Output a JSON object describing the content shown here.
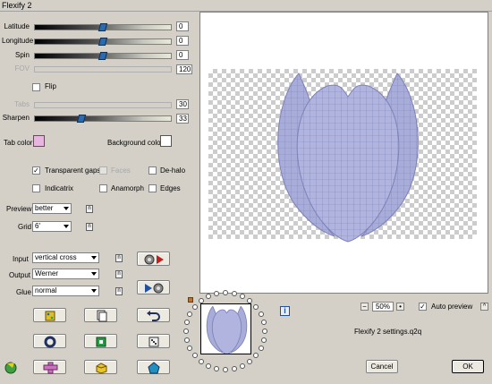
{
  "window": {
    "title": "Flexify 2"
  },
  "sliders": [
    {
      "label": "Latitude",
      "value": "0",
      "level": 0.5,
      "enabled": true
    },
    {
      "label": "Longitude",
      "value": "0",
      "level": 0.5,
      "enabled": true
    },
    {
      "label": "Spin",
      "value": "0",
      "level": 0.5,
      "enabled": true
    },
    {
      "label": "FOV",
      "value": "120",
      "enabled": false
    }
  ],
  "flip": {
    "label": "Flip",
    "checked": false
  },
  "tabs": {
    "label": "Tabs",
    "value": "30",
    "enabled": false
  },
  "sharpen": {
    "label": "Sharpen",
    "value": "33",
    "level": 0.33
  },
  "tab_color": {
    "label": "Tab color",
    "color": "#e8b4e0"
  },
  "background_color": {
    "label": "Background color",
    "color": "#ffffff"
  },
  "checkboxes": {
    "transparent_gaps": {
      "label": "Transparent gaps",
      "checked": true
    },
    "faces": {
      "label": "Faces",
      "checked": false,
      "enabled": false
    },
    "de_halo": {
      "label": "De-halo",
      "checked": false
    },
    "indicatrix": {
      "label": "Indicatrix",
      "checked": false
    },
    "anamorph": {
      "label": "Anamorph",
      "checked": false
    },
    "edges": {
      "label": "Edges",
      "checked": false
    }
  },
  "preview_quality": {
    "label": "Preview",
    "value": "better"
  },
  "grid": {
    "label": "Grid",
    "value": "6'"
  },
  "input": {
    "label": "Input",
    "value": "vertical cross"
  },
  "output": {
    "label": "Output",
    "value": "Werner"
  },
  "glue": {
    "label": "Glue",
    "value": "normal"
  },
  "lock_glyph": "n",
  "zoom": {
    "value": "50%"
  },
  "auto_preview": {
    "label": "Auto preview",
    "checked": true
  },
  "help_glyph": "^",
  "info_glyph": "i",
  "settings_file": "Flexify 2 settings.q2q",
  "cancel_label": "Cancel",
  "ok_label": "OK",
  "accent_colors": {
    "thumb": "#2a6ab0",
    "object": "#a8acd8"
  }
}
